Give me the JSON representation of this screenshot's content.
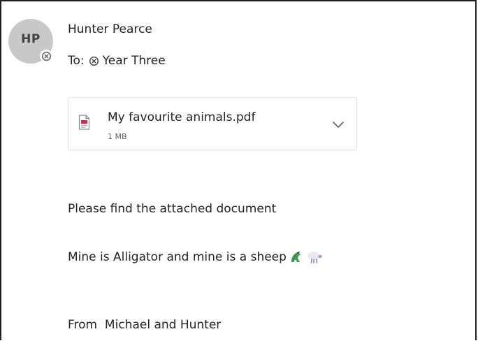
{
  "header": {
    "avatar_initials": "HP",
    "sender_name": "Hunter Pearce",
    "to_label": "To:",
    "recipient": "Year Three"
  },
  "attachment": {
    "file_name": "My favourite animals.pdf",
    "file_size": "1 MB",
    "file_icon": "pdf-file-icon",
    "expand_icon": "chevron-down-icon"
  },
  "message": {
    "line1": "Please find the attached document",
    "line2": "Mine is Alligator and mine is a sheep",
    "line2_emojis": [
      "alligator-emoji-icon",
      "sheep-emoji-icon"
    ],
    "line3": "From  Michael and Hunter"
  },
  "colors": {
    "avatar_bg": "#c8c8c8",
    "text": "#242424",
    "pdf_red": "#c4314b"
  }
}
